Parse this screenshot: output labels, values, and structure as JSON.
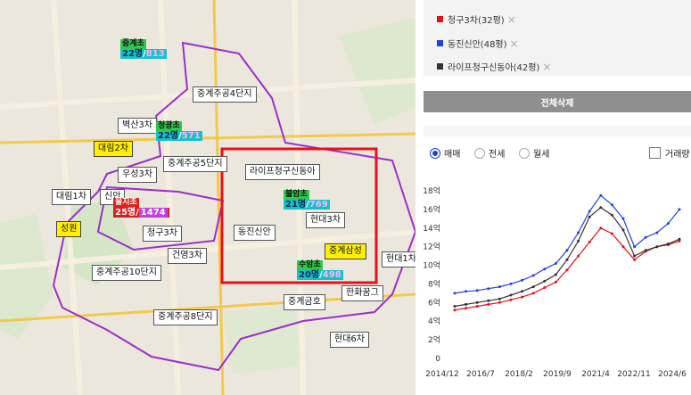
{
  "map": {
    "apartments": [
      {
        "text": "중계주공4단지",
        "hl": false
      },
      {
        "text": "벽산3차",
        "hl": false
      },
      {
        "text": "대림2차",
        "hl": true
      },
      {
        "text": "우성3차",
        "hl": false
      },
      {
        "text": "중계주공5단지",
        "hl": false
      },
      {
        "text": "라이프청구신동아",
        "hl": false
      },
      {
        "text": "대림1차",
        "hl": false
      },
      {
        "text": "신안",
        "hl": false
      },
      {
        "text": "성원",
        "hl": true
      },
      {
        "text": "청구3차",
        "hl": false
      },
      {
        "text": "현대3차",
        "hl": false
      },
      {
        "text": "동진신안",
        "hl": false
      },
      {
        "text": "중계삼성",
        "hl": true
      },
      {
        "text": "현대1차",
        "hl": false
      },
      {
        "text": "건영3차",
        "hl": false
      },
      {
        "text": "중계주공10단지",
        "hl": false
      },
      {
        "text": "한화꿈그",
        "hl": false
      },
      {
        "text": "중계금호",
        "hl": false
      },
      {
        "text": "중계주공8단지",
        "hl": false
      },
      {
        "text": "현대6차",
        "hl": false
      }
    ],
    "schools": [
      {
        "name": "중계초",
        "count": "22명",
        "ratio": "813",
        "red": false
      },
      {
        "name": "청광초",
        "count": "22명",
        "ratio": "571",
        "red": false
      },
      {
        "name": "을지초",
        "count": "25명",
        "ratio": "1474",
        "red": true
      },
      {
        "name": "불암초",
        "count": "21명",
        "ratio": "769",
        "red": false
      },
      {
        "name": "수암초",
        "count": "20명",
        "ratio": "498",
        "red": false
      }
    ]
  },
  "legend": {
    "items": [
      {
        "label": "청구3차(32평)",
        "color": "#e8101a"
      },
      {
        "label": "동진신안(48평)",
        "color": "#2240e6"
      },
      {
        "label": "라이프청구신동아(42평)",
        "color": "#333333"
      }
    ],
    "remove_glyph": "×"
  },
  "clear_button": "전체삭제",
  "trade_types": [
    {
      "label": "매매",
      "selected": true
    },
    {
      "label": "전세",
      "selected": false
    },
    {
      "label": "월세",
      "selected": false
    }
  ],
  "volume_checkbox": {
    "label": "거래량",
    "checked": false
  },
  "chart_data": {
    "type": "line",
    "x": [
      "2014/12",
      "2015/6",
      "2015/12",
      "2016/6",
      "2016/12",
      "2017/6",
      "2017/12",
      "2018/6",
      "2018/12",
      "2019/6",
      "2019/12",
      "2020/6",
      "2020/12",
      "2021/6",
      "2021/12",
      "2022/6",
      "2022/12",
      "2023/6",
      "2023/12",
      "2024/6",
      "2024/10"
    ],
    "x_tick_labels": [
      "2014/12",
      "2016/7",
      "2018/2",
      "2019/9",
      "2021/4",
      "2022/11",
      "2024/6"
    ],
    "y_tick_labels": [
      "0",
      "2억",
      "4억",
      "6억",
      "8억",
      "10억",
      "12억",
      "14억",
      "16억",
      "18억"
    ],
    "ylim": [
      0,
      18
    ],
    "grid": false,
    "series": [
      {
        "name": "청구3차(32평)",
        "color": "#e8101a",
        "values": [
          5.2,
          5.4,
          5.6,
          5.8,
          6.0,
          6.3,
          6.6,
          7.0,
          7.6,
          8.2,
          9.5,
          11.0,
          12.5,
          14.0,
          13.4,
          12.0,
          10.6,
          11.5,
          12.0,
          12.2,
          12.6
        ]
      },
      {
        "name": "동진신안(48평)",
        "color": "#2240e6",
        "values": [
          7.0,
          7.2,
          7.3,
          7.5,
          7.7,
          8.0,
          8.4,
          8.9,
          9.6,
          10.2,
          11.6,
          13.5,
          15.8,
          17.5,
          16.5,
          15.0,
          12.0,
          13.0,
          13.5,
          14.5,
          16.0
        ]
      },
      {
        "name": "라이프청구신동아(42평)",
        "color": "#333333",
        "values": [
          5.6,
          5.8,
          6.0,
          6.2,
          6.4,
          6.8,
          7.2,
          7.7,
          8.3,
          9.0,
          10.6,
          12.6,
          15.2,
          16.2,
          15.4,
          13.8,
          11.0,
          11.6,
          12.0,
          12.3,
          12.8
        ]
      }
    ]
  }
}
